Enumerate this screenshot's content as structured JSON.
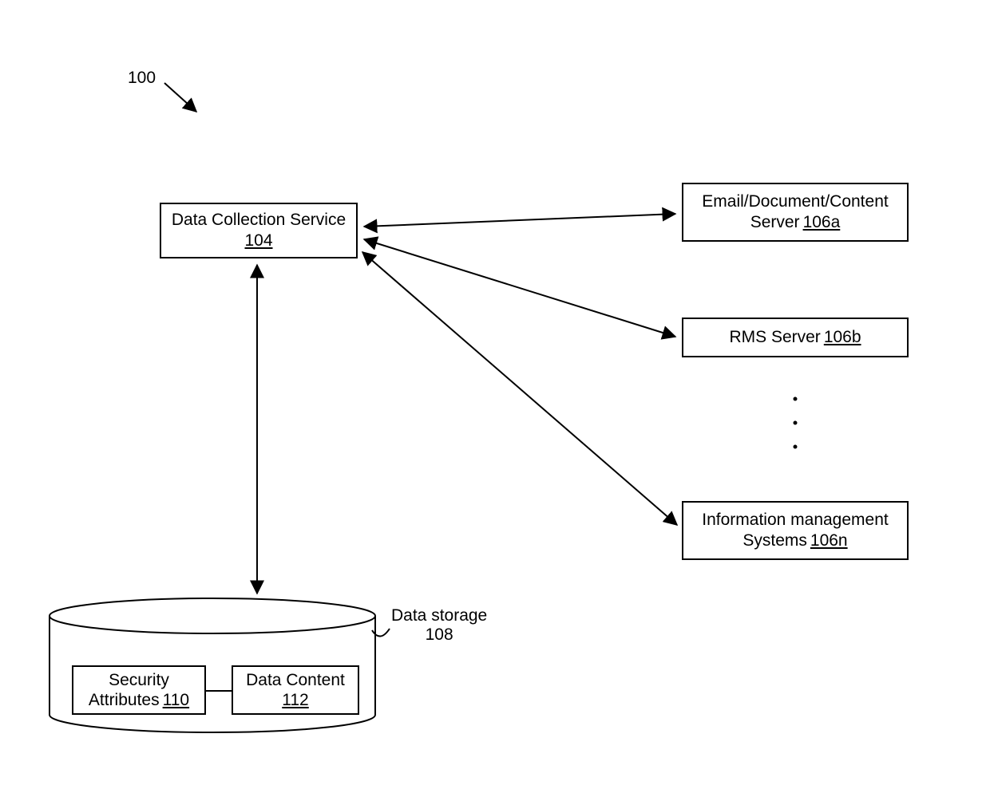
{
  "figure_ref": "100",
  "data_collection_service": {
    "title": "Data Collection Service",
    "ref": "104"
  },
  "email_server": {
    "line1": "Email/Document/Content",
    "line2_prefix": "Server",
    "ref": "106a"
  },
  "rms_server": {
    "prefix": "RMS Server",
    "ref": "106b"
  },
  "info_mgmt": {
    "line1": "Information management",
    "line2_prefix": "Systems",
    "ref": "106n"
  },
  "data_storage": {
    "label": "Data storage",
    "ref": "108"
  },
  "security_attributes": {
    "line1": "Security",
    "line2_prefix": "Attributes",
    "ref": "110"
  },
  "data_content": {
    "line1": "Data Content",
    "ref": "112"
  }
}
